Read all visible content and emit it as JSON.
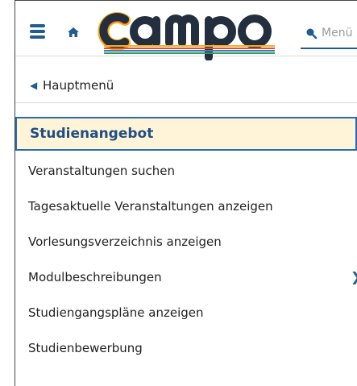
{
  "header": {
    "logo_text": "campo",
    "search_placeholder": "Menü"
  },
  "nav": {
    "back_label": "Hauptmenü",
    "active_label": "Studienangebot",
    "items": [
      "Veranstaltungen suchen",
      "Tagesaktuelle Veranstaltungen anzeigen",
      "Vorlesungsverzeichnis anzeigen",
      "Modulbeschreibungen",
      "Studiengangspläne anzeigen",
      "Studienbewerbung"
    ]
  },
  "colors": {
    "accent": "#1f5c92",
    "active_bg": "#fff4d8",
    "active_border": "#2a6ab0"
  },
  "icons": {
    "menu": "hamburger-icon",
    "home": "home-icon",
    "search": "search-icon",
    "back": "chevron-left-icon",
    "expand": "chevron-right-icon"
  }
}
